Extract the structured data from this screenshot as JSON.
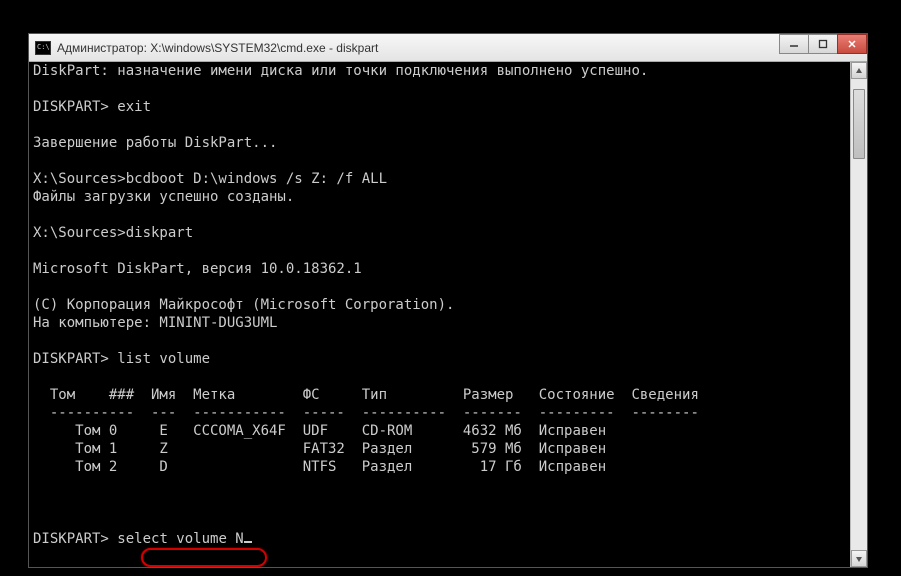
{
  "window": {
    "title": "Администратор: X:\\windows\\SYSTEM32\\cmd.exe - diskpart"
  },
  "controls": {
    "minimize": "—",
    "maximize": "☐",
    "close": "✕"
  },
  "console": {
    "lines": [
      "DiskPart: назначение имени диска или точки подключения выполнено успешно.",
      "",
      "DISKPART> exit",
      "",
      "Завершение работы DiskPart...",
      "",
      "X:\\Sources>bcdboot D:\\windows /s Z: /f ALL",
      "Файлы загрузки успешно созданы.",
      "",
      "X:\\Sources>diskpart",
      "",
      "Microsoft DiskPart, версия 10.0.18362.1",
      "",
      "(C) Корпорация Майкрософт (Microsoft Corporation).",
      "На компьютере: MININT-DUG3UML",
      "",
      "DISKPART> list volume",
      "",
      "  Том    ###  Имя  Метка        ФС     Тип         Размер   Состояние  Сведения",
      "  ----------  ---  -----------  -----  ----------  -------  ---------  --------",
      "     Том 0     E   CCCOMA_X64F  UDF    CD-ROM      4632 Мб  Исправен",
      "     Том 1     Z                FAT32  Раздел       579 Мб  Исправен",
      "     Том 2     D                NTFS   Раздел        17 Гб  Исправен",
      "",
      "",
      ""
    ],
    "final_prompt": "DISKPART> ",
    "final_input": "select volume N"
  }
}
